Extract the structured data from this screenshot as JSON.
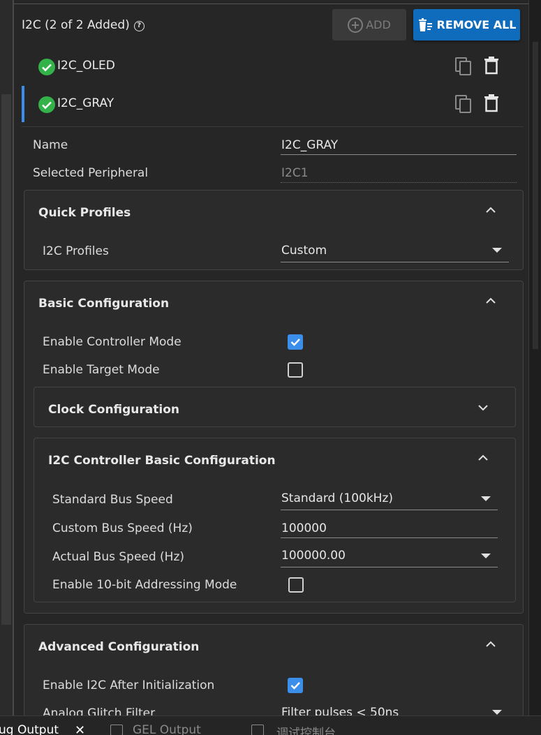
{
  "header": {
    "title": "I2C (2 of 2 Added)",
    "add_label": "ADD",
    "remove_all_label": "REMOVE ALL"
  },
  "instances": [
    {
      "name": "I2C_OLED",
      "selected": false,
      "status": "ok"
    },
    {
      "name": "I2C_GRAY",
      "selected": true,
      "status": "ok"
    }
  ],
  "fields": {
    "name_label": "Name",
    "name_value": "I2C_GRAY",
    "peripheral_label": "Selected Peripheral",
    "peripheral_value": "I2C1"
  },
  "quick_profiles": {
    "title": "Quick Profiles",
    "profiles_label": "I2C Profiles",
    "profiles_value": "Custom"
  },
  "basic_config": {
    "title": "Basic Configuration",
    "controller_mode_label": "Enable Controller Mode",
    "controller_mode_checked": true,
    "target_mode_label": "Enable Target Mode",
    "target_mode_checked": false,
    "clock_config_title": "Clock Configuration",
    "controller_basic": {
      "title": "I2C Controller Basic Configuration",
      "std_speed_label": "Standard Bus Speed",
      "std_speed_value": "Standard (100kHz)",
      "custom_speed_label": "Custom Bus Speed (Hz)",
      "custom_speed_value": "100000",
      "actual_speed_label": "Actual Bus Speed (Hz)",
      "actual_speed_value": "100000.00",
      "ten_bit_label": "Enable 10-bit Addressing Mode",
      "ten_bit_checked": false
    }
  },
  "advanced_config": {
    "title": "Advanced Configuration",
    "enable_after_init_label": "Enable I2C After Initialization",
    "enable_after_init_checked": true,
    "glitch_filter_label": "Analog Glitch Filter",
    "glitch_filter_value": "Filter pulses < 50ns"
  },
  "bottom_tabs": {
    "debug_output": "ug Output",
    "gel_output": "GEL Output",
    "debug_console": "调试控制台"
  },
  "colors": {
    "accent": "#0f6cbd",
    "selection_bar": "#3b8eea",
    "check_green": "#33b24a",
    "checkbox_blue": "#3b8eea",
    "panel_bg": "#262626",
    "card_bg": "#2b2b2b"
  },
  "icons": {
    "help": "help-icon",
    "add": "plus-circle-icon",
    "remove_all": "trash-list-icon",
    "status": "check-circle-icon",
    "copy": "copy-icon",
    "delete": "trash-icon",
    "collapse": "chevron-up-icon",
    "expand": "chevron-down-icon"
  }
}
